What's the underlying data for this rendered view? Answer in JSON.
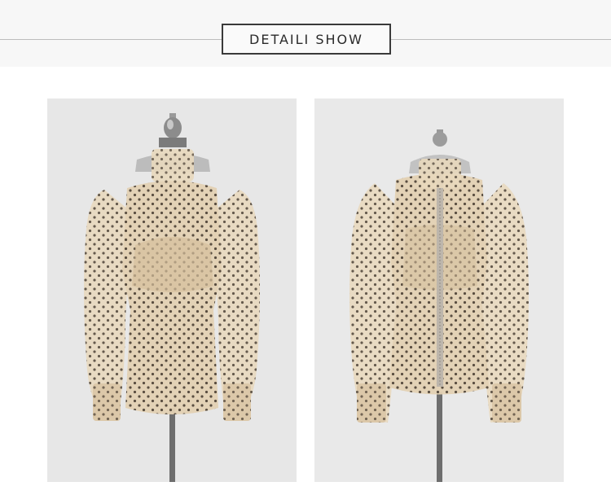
{
  "header": {
    "title": "DETAILI SHOW"
  },
  "photos": [
    {
      "view": "front",
      "subject": "polka-dot-mesh-blouse-front"
    },
    {
      "view": "back",
      "subject": "polka-dot-mesh-blouse-back"
    }
  ],
  "colors": {
    "fabric": "#e8d8bd",
    "fabric_shadow": "#d7c1a1",
    "dots": "#2b2119",
    "mannequin": "#8a8a8a",
    "background": "#e6e6e6"
  }
}
